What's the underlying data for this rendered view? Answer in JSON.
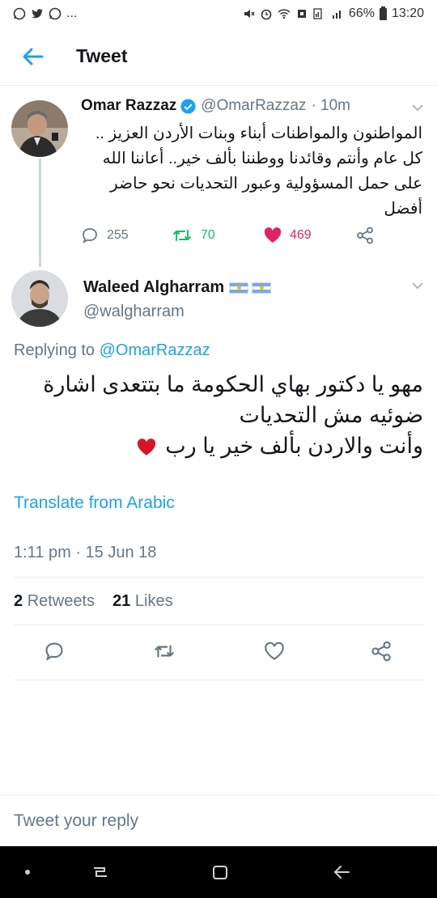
{
  "status_bar": {
    "time": "13:20",
    "battery": "66%",
    "overflow": "..."
  },
  "header": {
    "title": "Tweet",
    "back_icon": "arrow-left-icon"
  },
  "parent_tweet": {
    "name": "Omar Razzaz",
    "handle": "@OmarRazzaz",
    "age": "· 10m",
    "verified": true,
    "text_lines": [
      "المواطنون والمواطنات أبناء وبنات الأردن العزيز ..",
      "كل عام وأنتم وقائدنا ووطننا بألف خير.. أعاننا الله",
      "على حمل المسؤولية وعبور التحديات نحو حاضر",
      "أفضل"
    ],
    "replies": "255",
    "retweets": "70",
    "likes": "469"
  },
  "reply_tweet": {
    "name": "Waleed Algharram",
    "handle": "@walgharram",
    "replying_prefix": "Replying to",
    "replying_to": "@OmarRazzaz",
    "text_lines": [
      "مهو يا دكتور بهاي الحكومة ما بتتعدى اشارة",
      "ضوئيه مش التحديات",
      "وأنت والاردن بألف خير يا رب"
    ],
    "translate_label": "Translate from Arabic",
    "timestamp": "1:11 pm · 15 Jun 18",
    "retweet_count": "2",
    "retweet_label": "Retweets",
    "like_count": "21",
    "like_label": "Likes"
  },
  "reply_bar": {
    "placeholder": "Tweet your reply"
  },
  "colors": {
    "accent": "#1da1f2",
    "retweet_green": "#17bf63",
    "like_red": "#e0245e",
    "muted": "#657786"
  }
}
